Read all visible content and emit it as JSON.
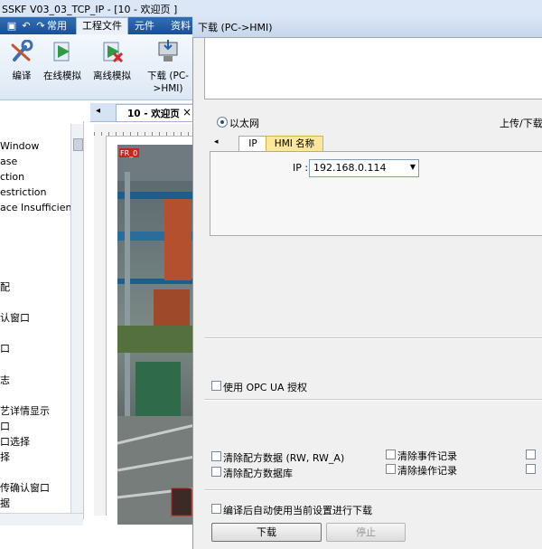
{
  "window": {
    "title": "SSKF V03_03_TCP_IP - [10 - 欢迎页 ]"
  },
  "menu_tabs": [
    "常用",
    "工程文件",
    "元件",
    "资料"
  ],
  "ribbon": {
    "compile": "编译",
    "online_sim": "在线模拟",
    "offline_sim": "离线模拟",
    "download_l1": "下载 (PC-",
    "download_l2": ">HMI)"
  },
  "tree_items": [
    "Window",
    "ase",
    "ction",
    "estriction",
    "ace Insufficient",
    "配",
    "认窗口",
    "口",
    "志",
    "艺详情显示",
    "口",
    "口选择",
    "择",
    "传确认窗口",
    "据"
  ],
  "doc_tab": {
    "arrow": "◂",
    "label": "10 - 欢迎页",
    "close": "×"
  },
  "canvas": {
    "tag": "FR_0"
  },
  "dialog": {
    "title": "下载 (PC->HMI)",
    "ethernet_label": "以太网",
    "upload_download_label": "上传/下载",
    "tab_arrow": "◂",
    "tab_ip": "IP",
    "tab_hmi_name": "HMI 名称",
    "ip_label": "IP :",
    "ip_value": "192.168.0.114",
    "opc_ua": "使用 OPC UA 授权",
    "clear_recipe_data": "清除配方数据 (RW, RW_A)",
    "clear_recipe_db": "清除配方数据库",
    "clear_event_log": "清除事件记录",
    "clear_operation_log": "清除操作记录",
    "auto_download": "编译后自动使用当前设置进行下载",
    "download_button": "下载",
    "stop_button": "停止"
  },
  "colors": {
    "accent": "#1b4f93",
    "tab_active": "#fde79a"
  }
}
